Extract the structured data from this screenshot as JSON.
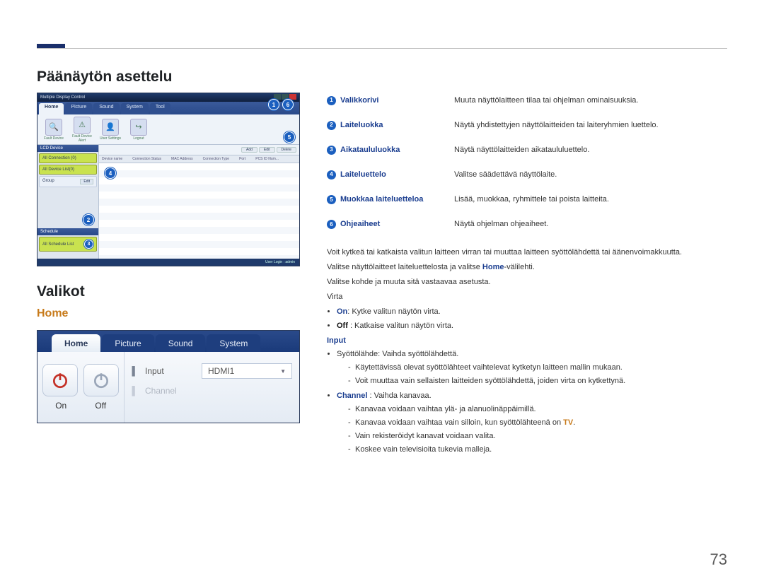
{
  "pageNumber": "73",
  "section1Title": "Päänäytön asettelu",
  "section2Title": "Valikot",
  "section2Sub": "Home",
  "shot1": {
    "windowTitle": "Multiple Display Control",
    "tabs": [
      "Home",
      "Picture",
      "Sound",
      "System",
      "Tool"
    ],
    "toolbar": [
      {
        "icon": "🔍",
        "label": "Fault Device"
      },
      {
        "icon": "⚠",
        "label": "Fault Device Alert"
      },
      {
        "icon": "👤",
        "label": "User Settings"
      },
      {
        "icon": "↪",
        "label": "Logout"
      }
    ],
    "sideHeader": "LCD Device",
    "sideItems": [
      "All Connection (0)",
      "All Device List(0)"
    ],
    "sideGroupLabel": "Group",
    "sideGroupEdit": "Edit",
    "scheduleHeader": "Schedule",
    "scheduleItem": "All Schedule List",
    "rowBtns": [
      "Add",
      "Edit",
      "Delete"
    ],
    "thead": [
      "Device name",
      "Connection Status",
      "MAC Address",
      "Connection Type",
      "Port",
      "PCS ID Num..."
    ],
    "status": "User Login : admin"
  },
  "shot2": {
    "tabs": [
      "Home",
      "Picture",
      "Sound",
      "System"
    ],
    "onLabel": "On",
    "offLabel": "Off",
    "inputLabel": "Input",
    "channelLabel": "Channel",
    "inputValue": "HDMI1"
  },
  "desc": [
    {
      "n": "1",
      "label": "Valikkorivi",
      "text": "Muuta näyttölaitteen tilaa tai ohjelman ominaisuuksia."
    },
    {
      "n": "2",
      "label": "Laiteluokka",
      "text": "Näytä yhdistettyjen näyttölaitteiden tai laiteryhmien luettelo."
    },
    {
      "n": "3",
      "label": "Aikataululuokka",
      "text": "Näytä näyttölaitteiden aikataululuettelo."
    },
    {
      "n": "4",
      "label": "Laiteluettelo",
      "text": "Valitse säädettävä näyttölaite."
    },
    {
      "n": "5",
      "label": "Muokkaa laiteluetteloa",
      "text": "Lisää, muokkaa, ryhmittele tai poista laitteita."
    },
    {
      "n": "6",
      "label": "Ohjeaiheet",
      "text": "Näytä ohjelman ohjeaiheet."
    }
  ],
  "intro1": "Voit kytkeä tai katkaista valitun laitteen virran tai muuttaa laitteen syöttölähdettä tai äänenvoimakkuutta.",
  "intro2_a": "Valitse näyttölaitteet laiteluettelosta ja valitse ",
  "intro2_b": "Home",
  "intro2_c": "-välilehti.",
  "intro3": "Valitse kohde ja muuta sitä vastaavaa asetusta.",
  "virtaHeader": "Virta",
  "virta_on_a": "On",
  "virta_on_b": ": Kytke valitun näytön virta.",
  "virta_off_a": "Off",
  "virta_off_b": " : Katkaise valitun näytön virta.",
  "inputHeader": "Input",
  "input1": "Syöttölähde: Vaihda syöttölähdettä.",
  "input1a": "Käytettävissä olevat syöttölähteet vaihtelevat kytketyn laitteen mallin mukaan.",
  "input1b": "Voit muuttaa vain sellaisten laitteiden syöttölähdettä, joiden virta on kytkettynä.",
  "channel_a": "Channel",
  "channel_b": " : Vaihda kanavaa.",
  "ch1": "Kanavaa voidaan vaihtaa ylä- ja alanuolinäppäimillä.",
  "ch2_a": "Kanavaa voidaan vaihtaa vain silloin, kun syöttölähteenä on ",
  "ch2_b": "TV",
  "ch2_c": ".",
  "ch3": "Vain rekisteröidyt kanavat voidaan valita.",
  "ch4": "Koskee vain televisioita tukevia malleja."
}
